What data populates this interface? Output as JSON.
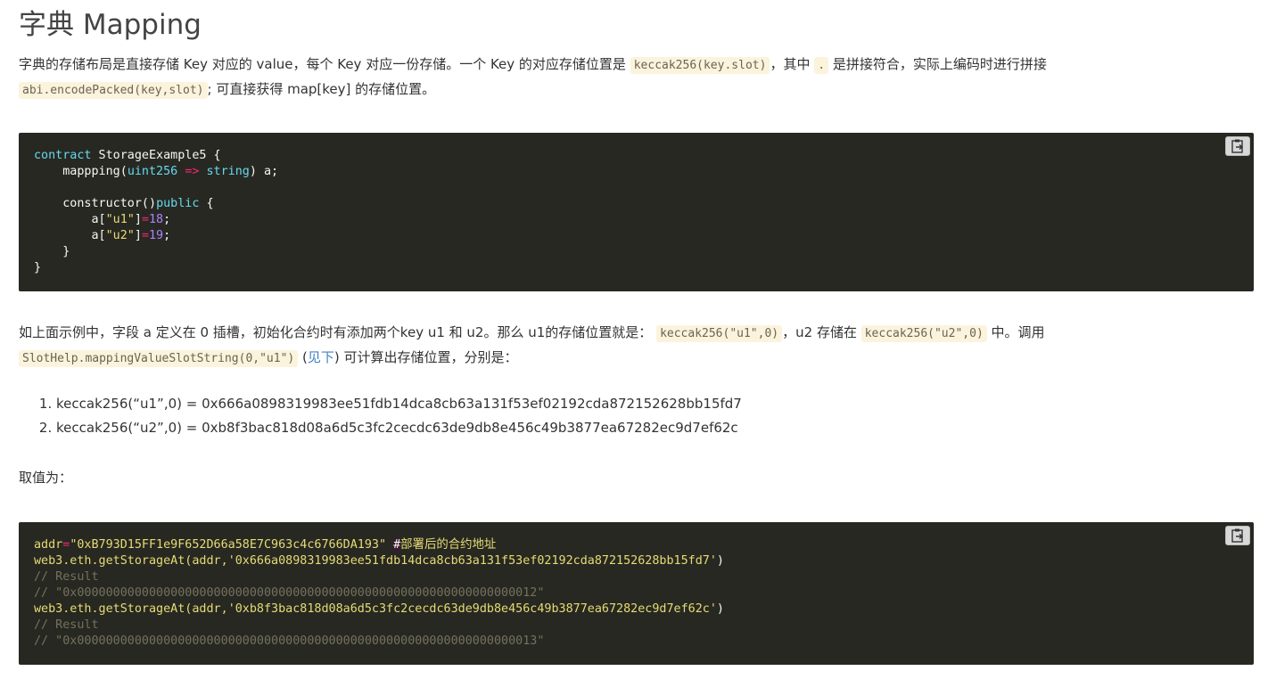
{
  "heading": "字典 Mapping",
  "intro": {
    "p1": "字典的存储布局是直接存储 Key 对应的 value，每个 Key 对应一份存储。一个 Key 的对应存储位置是 ",
    "code1": "keccak256(key.slot)",
    "p2": "，其中 ",
    "code2": ".",
    "p3": " 是拼接符合，实际上编码时进行拼接",
    "code3": "abi.encodePacked(key,slot)",
    "p4": "; 可直接获得 map[key] 的存储位置。"
  },
  "code_block_1": {
    "line1_kw": "contract",
    "line1_rest": " StorageExample5 {",
    "line2_a": "    mappping(",
    "line2_type": "uint256",
    "line2_arrow": "=>",
    "line2_type2": "string",
    "line2_b": ") a;",
    "line4_a": "    constructor()",
    "line4_kw": "public",
    "line4_b": " {",
    "line5_a": "        a[",
    "line5_str": "\"u1\"",
    "line5_b": "]",
    "line5_op": "=",
    "line5_num": "18",
    "line5_c": ";",
    "line6_a": "        a[",
    "line6_str": "\"u2\"",
    "line6_b": "]",
    "line6_op": "=",
    "line6_num": "19",
    "line6_c": ";",
    "line7": "    }",
    "line8": "}"
  },
  "explain": {
    "p1": "如上面示例中，字段 a 定义在 0 插槽，初始化合约时有添加两个key u1 和 u2。那么 u1的存储位置就是： ",
    "code1": "keccak256(\"u1\",0)",
    "p2": "，u2 存储在 ",
    "code2": "keccak256(\"u2\",0)",
    "p3": " 中。调用",
    "code3": "SlotHelp.mappingValueSlotString(0,\"u1\")",
    "p4": " (",
    "link": "见下",
    "p5": ") 可计算出存储位置，分别是："
  },
  "list_items": [
    "keccak256(“u1”,0) = 0x666a0898319983ee51fdb14dca8cb63a131f53ef02192cda872152628bb15fd7",
    "keccak256(“u2”,0) = 0xb8f3bac818d08a6d5c3fc2cecdc63de9db8e456c49b3877ea67282ec9d7ef62c"
  ],
  "values_label": "取值为：",
  "code_block_2": {
    "l1_var": "addr",
    "l1_op": "=",
    "l1_str": "\"0xB793D15FF1e9F652D66a58E7C963c4c6766DA193\"",
    "l1_sp": " ",
    "l1_hash": "#",
    "l1_comment": "部署后的合约地址",
    "l2_a": "web3.eth.getStorageAt(",
    "l2_b": "addr,",
    "l2_str": "'0x666a0898319983ee51fdb14dca8cb63a131f53ef02192cda872152628bb15fd7'",
    "l2_c": ")",
    "l3": "// Result",
    "l4": "// \"0x0000000000000000000000000000000000000000000000000000000000000012\"",
    "l5_a": "web3.eth.getStorageAt(",
    "l5_b": "addr,",
    "l5_str": "'0xb8f3bac818d08a6d5c3fc2cecdc63de9db8e456c49b3877ea67282ec9d7ef62c'",
    "l5_c": ")",
    "l6": "// Result",
    "l7": "// \"0x0000000000000000000000000000000000000000000000000000000000000013\""
  },
  "icons": {
    "copy": "clipboard-icon"
  }
}
